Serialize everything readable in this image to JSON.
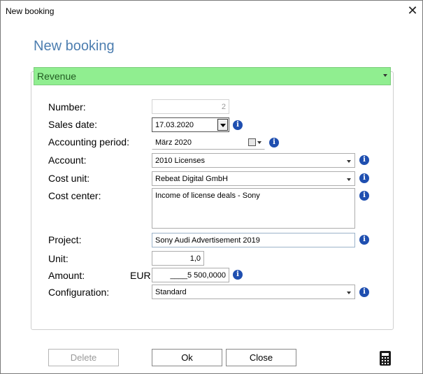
{
  "window": {
    "title": "New booking",
    "close_glyph": "✕"
  },
  "heading": "New booking",
  "booking_type": {
    "value": "Revenue",
    "color": "#90ee90"
  },
  "form": {
    "number": {
      "label": "Number:",
      "value": "2"
    },
    "sales_date": {
      "label": "Sales date:",
      "value": "17.03.2020"
    },
    "accounting_period": {
      "label": "Accounting period:",
      "value": "März 2020"
    },
    "account": {
      "label": "Account:",
      "value": "2010 Licenses"
    },
    "cost_unit": {
      "label": "Cost unit:",
      "value": "Rebeat Digital GmbH"
    },
    "cost_center": {
      "label": "Cost center:",
      "value": "Income of license deals - Sony"
    },
    "project": {
      "label": "Project:",
      "value": "Sony Audi Advertisement 2019"
    },
    "unit": {
      "label": "Unit:",
      "value": "1,0"
    },
    "amount": {
      "label": "Amount:",
      "currency": "EUR",
      "value": "____5 500,0000"
    },
    "configuration": {
      "label": "Configuration:",
      "value": "Standard"
    }
  },
  "icons": {
    "info": "i",
    "info_color": "#1f4fb0",
    "accent": "#4d7eb0"
  },
  "buttons": {
    "delete": "Delete",
    "ok": "Ok",
    "close": "Close"
  }
}
